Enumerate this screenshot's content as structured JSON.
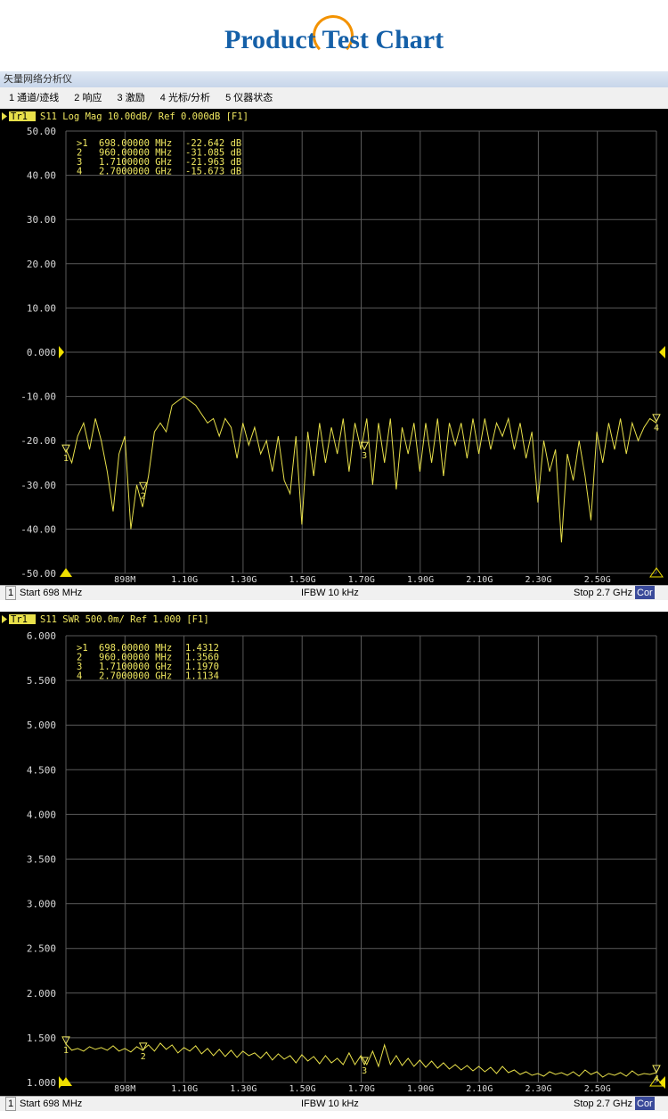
{
  "page": {
    "title": "Product Test Chart"
  },
  "window": {
    "title": "矢量网络分析仪",
    "menu": [
      "1 通道/迹线",
      "2 响应",
      "3 激励",
      "4 光标/分析",
      "5 仪器状态"
    ]
  },
  "colors": {
    "trace": "#e8e04a",
    "grid": "#5a5a5a",
    "axis_text": "#d8d8d8",
    "marker_text": "#f0e860",
    "background": "#000000"
  },
  "status": {
    "channel": "1",
    "start": "Start 698 MHz",
    "ifbw": "IFBW 10 kHz",
    "stop": "Stop 2.7 GHz",
    "cor": "Cor"
  },
  "chart_data": [
    {
      "type": "line",
      "trace_label": "Tr1",
      "header": "S11 Log Mag 10.00dB/ Ref 0.000dB [F1]",
      "y_ticks": [
        "50.00",
        "40.00",
        "30.00",
        "20.00",
        "10.00",
        "0.000",
        "-10.00",
        "-20.00",
        "-30.00",
        "-40.00",
        "-50.00"
      ],
      "ylim": [
        -50,
        50
      ],
      "x_ticks": [
        {
          "label": "898M",
          "x": 898
        },
        {
          "label": "1.10G",
          "x": 1100
        },
        {
          "label": "1.30G",
          "x": 1300
        },
        {
          "label": "1.50G",
          "x": 1500
        },
        {
          "label": "1.70G",
          "x": 1700
        },
        {
          "label": "1.90G",
          "x": 1900
        },
        {
          "label": "2.10G",
          "x": 2100
        },
        {
          "label": "2.30G",
          "x": 2300
        },
        {
          "label": "2.50G",
          "x": 2500
        }
      ],
      "xlim": [
        698,
        2700
      ],
      "markers": [
        {
          "id": ">1",
          "freq": "698.00000 MHz",
          "value": "-22.642 dB"
        },
        {
          "id": "2",
          "freq": "960.00000 MHz",
          "value": "-31.085 dB"
        },
        {
          "id": "3",
          "freq": "1.7100000 GHz",
          "value": "-21.963 dB"
        },
        {
          "id": "4",
          "freq": "2.7000000 GHz",
          "value": "-15.673 dB"
        }
      ],
      "marker_points": [
        {
          "label": "1",
          "x": 698,
          "y": -22.6
        },
        {
          "label": "2",
          "x": 960,
          "y": -31.1
        },
        {
          "label": "3",
          "x": 1710,
          "y": -22.0
        },
        {
          "label": "4",
          "x": 2700,
          "y": -15.7
        }
      ],
      "x": [
        698,
        718,
        738,
        758,
        778,
        798,
        818,
        838,
        858,
        878,
        898,
        918,
        938,
        958,
        978,
        998,
        1018,
        1038,
        1058,
        1078,
        1098,
        1118,
        1138,
        1158,
        1178,
        1198,
        1218,
        1238,
        1258,
        1278,
        1298,
        1318,
        1338,
        1358,
        1378,
        1398,
        1418,
        1438,
        1458,
        1478,
        1498,
        1518,
        1538,
        1558,
        1578,
        1598,
        1618,
        1638,
        1658,
        1678,
        1698,
        1718,
        1738,
        1758,
        1778,
        1798,
        1818,
        1838,
        1858,
        1878,
        1898,
        1918,
        1938,
        1958,
        1978,
        1998,
        2018,
        2038,
        2058,
        2078,
        2098,
        2118,
        2138,
        2158,
        2178,
        2198,
        2218,
        2238,
        2258,
        2278,
        2298,
        2318,
        2338,
        2358,
        2378,
        2398,
        2418,
        2438,
        2458,
        2478,
        2498,
        2518,
        2538,
        2558,
        2578,
        2598,
        2618,
        2638,
        2658,
        2678,
        2700
      ],
      "y": [
        -22,
        -25,
        -19,
        -16,
        -22,
        -15,
        -20,
        -27,
        -36,
        -23,
        -19,
        -40,
        -30,
        -35,
        -28,
        -18,
        -16,
        -18,
        -12,
        -11,
        -10,
        -11,
        -12,
        -14,
        -16,
        -15,
        -19,
        -15,
        -17,
        -24,
        -16,
        -21,
        -17,
        -23,
        -20,
        -27,
        -19,
        -29,
        -32,
        -19,
        -39,
        -18,
        -28,
        -16,
        -25,
        -17,
        -23,
        -15,
        -27,
        -16,
        -22,
        -15,
        -30,
        -16,
        -25,
        -15,
        -31,
        -17,
        -23,
        -16,
        -27,
        -16,
        -25,
        -15,
        -28,
        -16,
        -21,
        -16,
        -24,
        -15,
        -23,
        -15,
        -22,
        -16,
        -19,
        -15,
        -22,
        -16,
        -24,
        -18,
        -34,
        -20,
        -27,
        -22,
        -43,
        -23,
        -29,
        -20,
        -28,
        -38,
        -18,
        -25,
        -16,
        -22,
        -15,
        -23,
        -16,
        -20,
        -17,
        -15,
        -16
      ]
    },
    {
      "type": "line",
      "trace_label": "Tr1",
      "header": "S11 SWR 500.0m/ Ref 1.000 [F1]",
      "y_ticks": [
        "6.000",
        "5.500",
        "5.000",
        "4.500",
        "4.000",
        "3.500",
        "3.000",
        "2.500",
        "2.000",
        "1.500",
        "1.000"
      ],
      "ylim": [
        1,
        6
      ],
      "x_ticks": [
        {
          "label": "898M",
          "x": 898
        },
        {
          "label": "1.10G",
          "x": 1100
        },
        {
          "label": "1.30G",
          "x": 1300
        },
        {
          "label": "1.50G",
          "x": 1500
        },
        {
          "label": "1.70G",
          "x": 1700
        },
        {
          "label": "1.90G",
          "x": 1900
        },
        {
          "label": "2.10G",
          "x": 2100
        },
        {
          "label": "2.30G",
          "x": 2300
        },
        {
          "label": "2.50G",
          "x": 2500
        }
      ],
      "xlim": [
        698,
        2700
      ],
      "markers": [
        {
          "id": ">1",
          "freq": "698.00000 MHz",
          "value": "1.4312"
        },
        {
          "id": "2",
          "freq": "960.00000 MHz",
          "value": "1.3560"
        },
        {
          "id": "3",
          "freq": "1.7100000 GHz",
          "value": "1.1970"
        },
        {
          "id": "4",
          "freq": "2.7000000 GHz",
          "value": "1.1134"
        }
      ],
      "marker_points": [
        {
          "label": "1",
          "x": 698,
          "y": 1.43
        },
        {
          "label": "2",
          "x": 960,
          "y": 1.36
        },
        {
          "label": "3",
          "x": 1710,
          "y": 1.2
        },
        {
          "label": "4",
          "x": 2700,
          "y": 1.11
        }
      ],
      "x": [
        698,
        718,
        738,
        758,
        778,
        798,
        818,
        838,
        858,
        878,
        898,
        918,
        938,
        958,
        978,
        998,
        1018,
        1038,
        1058,
        1078,
        1098,
        1118,
        1138,
        1158,
        1178,
        1198,
        1218,
        1238,
        1258,
        1278,
        1298,
        1318,
        1338,
        1358,
        1378,
        1398,
        1418,
        1438,
        1458,
        1478,
        1498,
        1518,
        1538,
        1558,
        1578,
        1598,
        1618,
        1638,
        1658,
        1678,
        1698,
        1718,
        1738,
        1758,
        1778,
        1798,
        1818,
        1838,
        1858,
        1878,
        1898,
        1918,
        1938,
        1958,
        1978,
        1998,
        2018,
        2038,
        2058,
        2078,
        2098,
        2118,
        2138,
        2158,
        2178,
        2198,
        2218,
        2238,
        2258,
        2278,
        2298,
        2318,
        2338,
        2358,
        2378,
        2398,
        2418,
        2438,
        2458,
        2478,
        2498,
        2518,
        2538,
        2558,
        2578,
        2598,
        2618,
        2638,
        2658,
        2678,
        2700
      ],
      "y": [
        1.43,
        1.36,
        1.38,
        1.35,
        1.4,
        1.37,
        1.39,
        1.36,
        1.41,
        1.35,
        1.38,
        1.34,
        1.4,
        1.36,
        1.42,
        1.35,
        1.44,
        1.37,
        1.42,
        1.33,
        1.39,
        1.35,
        1.41,
        1.32,
        1.38,
        1.3,
        1.37,
        1.29,
        1.36,
        1.28,
        1.35,
        1.3,
        1.33,
        1.27,
        1.34,
        1.25,
        1.32,
        1.26,
        1.3,
        1.22,
        1.31,
        1.24,
        1.29,
        1.21,
        1.3,
        1.22,
        1.27,
        1.2,
        1.33,
        1.2,
        1.3,
        1.2,
        1.35,
        1.18,
        1.42,
        1.2,
        1.3,
        1.19,
        1.27,
        1.18,
        1.25,
        1.17,
        1.24,
        1.16,
        1.22,
        1.15,
        1.2,
        1.14,
        1.19,
        1.13,
        1.18,
        1.12,
        1.17,
        1.1,
        1.18,
        1.11,
        1.14,
        1.09,
        1.12,
        1.08,
        1.1,
        1.07,
        1.12,
        1.09,
        1.11,
        1.08,
        1.12,
        1.07,
        1.14,
        1.09,
        1.12,
        1.06,
        1.1,
        1.08,
        1.11,
        1.07,
        1.13,
        1.08,
        1.1,
        1.09,
        1.11
      ]
    }
  ]
}
